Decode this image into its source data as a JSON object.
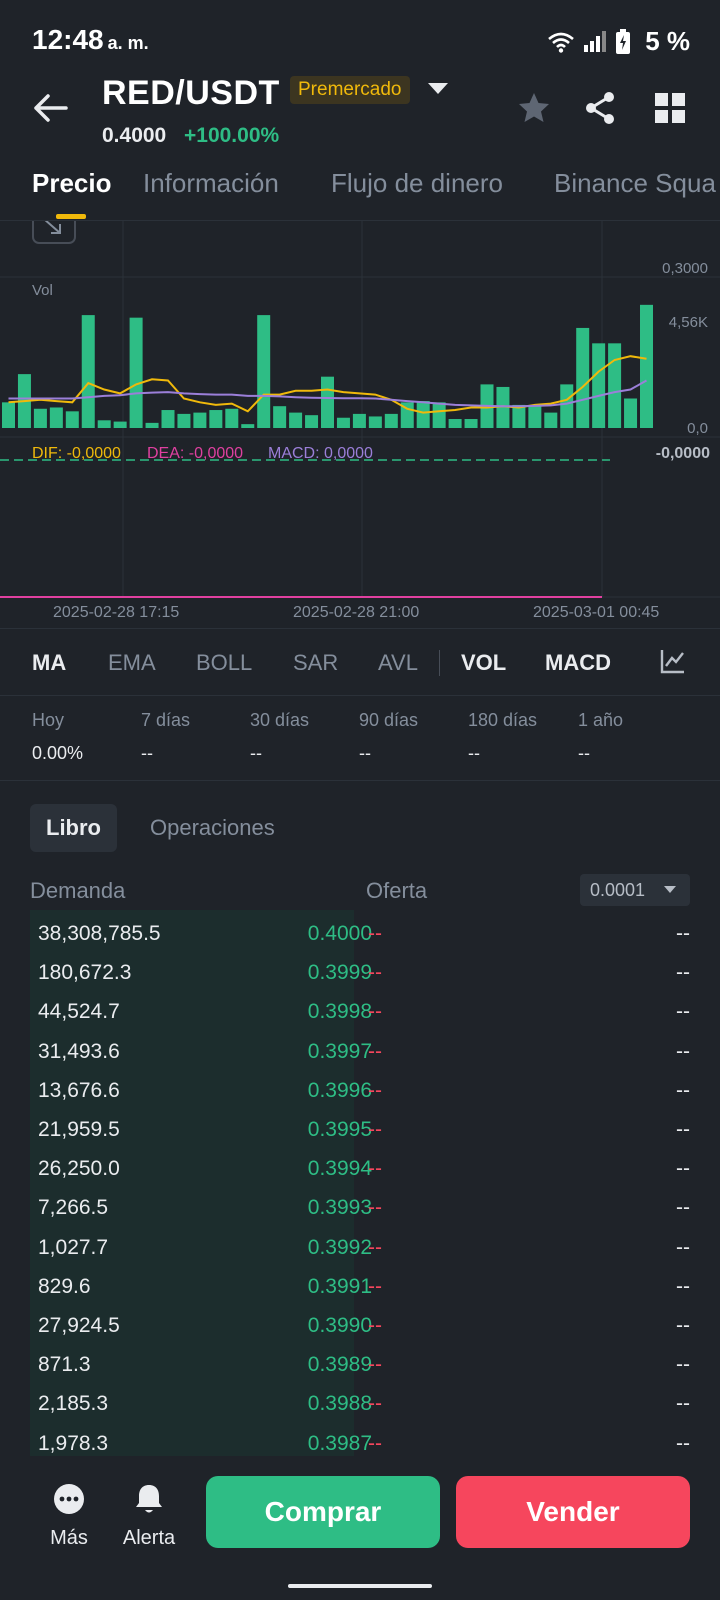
{
  "status_bar": {
    "time": "12:48",
    "ampm": "a. m.",
    "battery": "5 %"
  },
  "header": {
    "pair": "RED/USDT",
    "badge": "Premercado",
    "price": "0.4000",
    "change": "+100.00%",
    "icons": [
      "back-arrow-icon",
      "star-icon",
      "share-icon",
      "grid-icon"
    ]
  },
  "tabs": [
    "Precio",
    "Información",
    "Flujo de dinero",
    "Binance Squa"
  ],
  "chart": {
    "price_axis_label": "0,3000",
    "vol_label": "Vol",
    "vol_axis_top": "4,56K",
    "vol_axis_zero": "0,0",
    "macd_legend": {
      "dif": "DIF: -0,0000",
      "dea": "DEA: -0,0000",
      "macd": "MACD: 0,0000"
    },
    "macd_axis_label": "-0,0000",
    "dates": [
      "2025-02-28 17:15",
      "2025-02-28 21:00",
      "2025-03-01 00:45"
    ],
    "colors": {
      "up": "#2ebd85",
      "ma_fast": "#f0b90b",
      "ma_slow": "#9b7fd9",
      "dea": "#e040a0"
    }
  },
  "chart_data": {
    "type": "bar",
    "title": "",
    "ylabel": "Vol",
    "ylim": [
      0,
      4560
    ],
    "values": [
      1000,
      2100,
      750,
      800,
      650,
      4400,
      300,
      250,
      4300,
      200,
      700,
      550,
      600,
      700,
      750,
      150,
      4400,
      850,
      600,
      500,
      2000,
      400,
      550,
      450,
      550,
      1000,
      1050,
      1000,
      350,
      350,
      1700,
      1600,
      900,
      900,
      600,
      1700,
      3900,
      3300,
      3300,
      1150,
      4800
    ],
    "series": [
      {
        "name": "MA7",
        "values": [
          1000,
          1050,
          1100,
          1050,
          1000,
          1750,
          1500,
          1350,
          1700,
          1900,
          1850,
          1150,
          1000,
          900,
          950,
          650,
          1300,
          1300,
          1450,
          1450,
          1500,
          1400,
          1350,
          1300,
          1100,
          750,
          600,
          650,
          700,
          800,
          800,
          850,
          800,
          900,
          950,
          1100,
          1600,
          2200,
          2650,
          2800,
          2700
        ]
      },
      {
        "name": "MA25",
        "values": [
          1150,
          1150,
          1150,
          1150,
          1150,
          1200,
          1250,
          1280,
          1350,
          1380,
          1400,
          1350,
          1320,
          1300,
          1300,
          1250,
          1250,
          1230,
          1200,
          1180,
          1170,
          1160,
          1160,
          1150,
          1100,
          1050,
          1000,
          950,
          900,
          880,
          860,
          850,
          850,
          860,
          880,
          950,
          1100,
          1250,
          1400,
          1500,
          1850
        ]
      }
    ]
  },
  "indicators": [
    "MA",
    "EMA",
    "BOLL",
    "SAR",
    "AVL",
    "VOL",
    "MACD"
  ],
  "performance": [
    {
      "label": "Hoy",
      "value": "0.00%"
    },
    {
      "label": "7 días",
      "value": "--"
    },
    {
      "label": "30 días",
      "value": "--"
    },
    {
      "label": "90 días",
      "value": "--"
    },
    {
      "label": "180 días",
      "value": "--"
    },
    {
      "label": "1 año",
      "value": "--"
    }
  ],
  "book": {
    "tabs": [
      "Libro",
      "Operaciones"
    ],
    "demand_header": "Demanda",
    "offer_header": "Oferta",
    "precision": "0.0001",
    "rows": [
      {
        "qty": "38,308,785.5",
        "price": "0.4000",
        "ask": "--",
        "ask_qty": "--"
      },
      {
        "qty": "180,672.3",
        "price": "0.3999",
        "ask": "--",
        "ask_qty": "--"
      },
      {
        "qty": "44,524.7",
        "price": "0.3998",
        "ask": "--",
        "ask_qty": "--"
      },
      {
        "qty": "31,493.6",
        "price": "0.3997",
        "ask": "--",
        "ask_qty": "--"
      },
      {
        "qty": "13,676.6",
        "price": "0.3996",
        "ask": "--",
        "ask_qty": "--"
      },
      {
        "qty": "21,959.5",
        "price": "0.3995",
        "ask": "--",
        "ask_qty": "--"
      },
      {
        "qty": "26,250.0",
        "price": "0.3994",
        "ask": "--",
        "ask_qty": "--"
      },
      {
        "qty": "7,266.5",
        "price": "0.3993",
        "ask": "--",
        "ask_qty": "--"
      },
      {
        "qty": "1,027.7",
        "price": "0.3992",
        "ask": "--",
        "ask_qty": "--"
      },
      {
        "qty": "829.6",
        "price": "0.3991",
        "ask": "--",
        "ask_qty": "--"
      },
      {
        "qty": "27,924.5",
        "price": "0.3990",
        "ask": "--",
        "ask_qty": "--"
      },
      {
        "qty": "871.3",
        "price": "0.3989",
        "ask": "--",
        "ask_qty": "--"
      },
      {
        "qty": "2,185.3",
        "price": "0.3988",
        "ask": "--",
        "ask_qty": "--"
      },
      {
        "qty": "1,978.3",
        "price": "0.3987",
        "ask": "--",
        "ask_qty": "--"
      }
    ]
  },
  "bottom": {
    "more": "Más",
    "alert": "Alerta",
    "buy": "Comprar",
    "sell": "Vender"
  }
}
